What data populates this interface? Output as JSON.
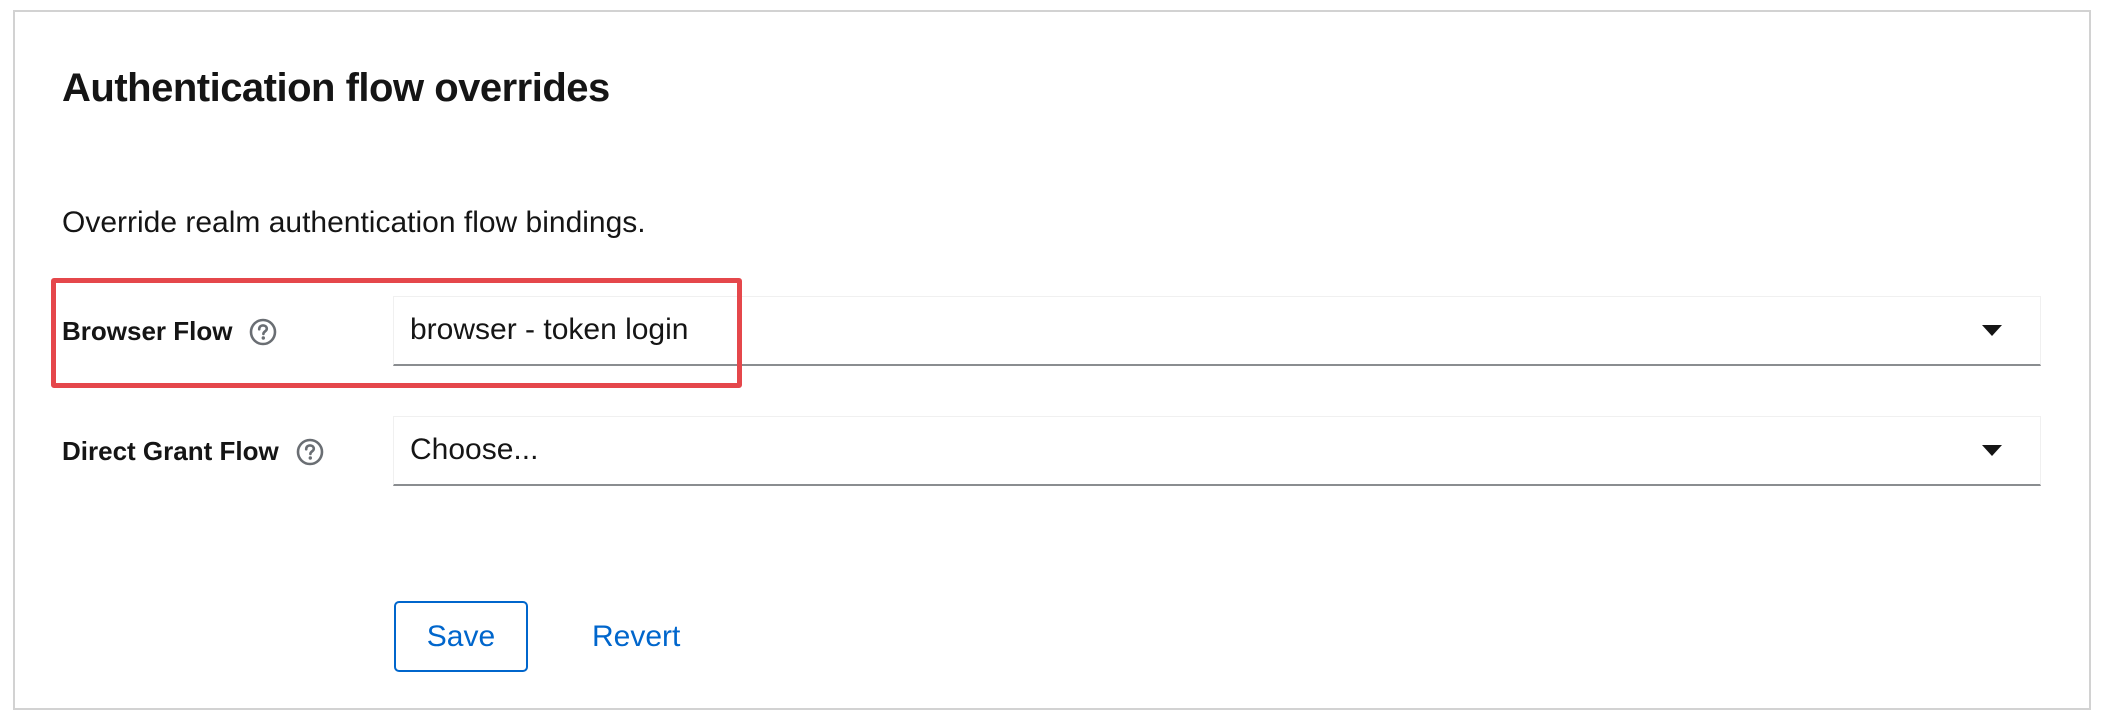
{
  "section": {
    "title": "Authentication flow overrides",
    "description": "Override realm authentication flow bindings."
  },
  "fields": [
    {
      "label": "Browser Flow",
      "value": "browser - token login",
      "help_icon": "question-circle-icon",
      "caret_icon": "caret-down-icon"
    },
    {
      "label": "Direct Grant Flow",
      "value": "Choose...",
      "help_icon": "question-circle-icon",
      "caret_icon": "caret-down-icon"
    }
  ],
  "actions": {
    "save_label": "Save",
    "revert_label": "Revert"
  },
  "colors": {
    "accent": "#0066cc",
    "highlight": "#e5474b",
    "text": "#151515",
    "border": "#d2d2d2"
  }
}
